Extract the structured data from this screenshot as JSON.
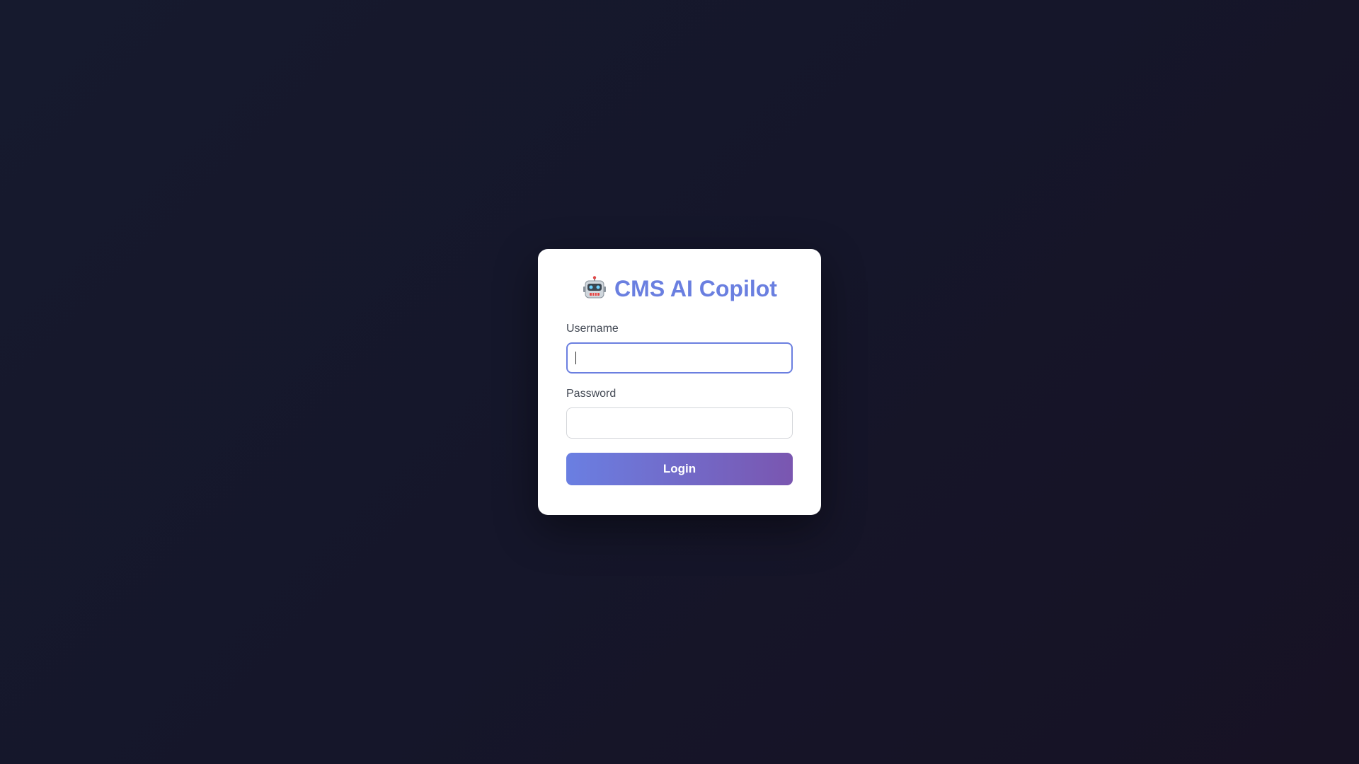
{
  "login": {
    "title": "CMS AI Copilot",
    "title_icon": "robot-icon",
    "username_label": "Username",
    "username_value": "",
    "password_label": "Password",
    "password_value": "",
    "login_button": "Login"
  },
  "colors": {
    "accent": "#6a7fe0",
    "button_gradient_start": "#6a7fe2",
    "button_gradient_end": "#7a56b0",
    "background": "#15162a",
    "card": "#ffffff"
  }
}
